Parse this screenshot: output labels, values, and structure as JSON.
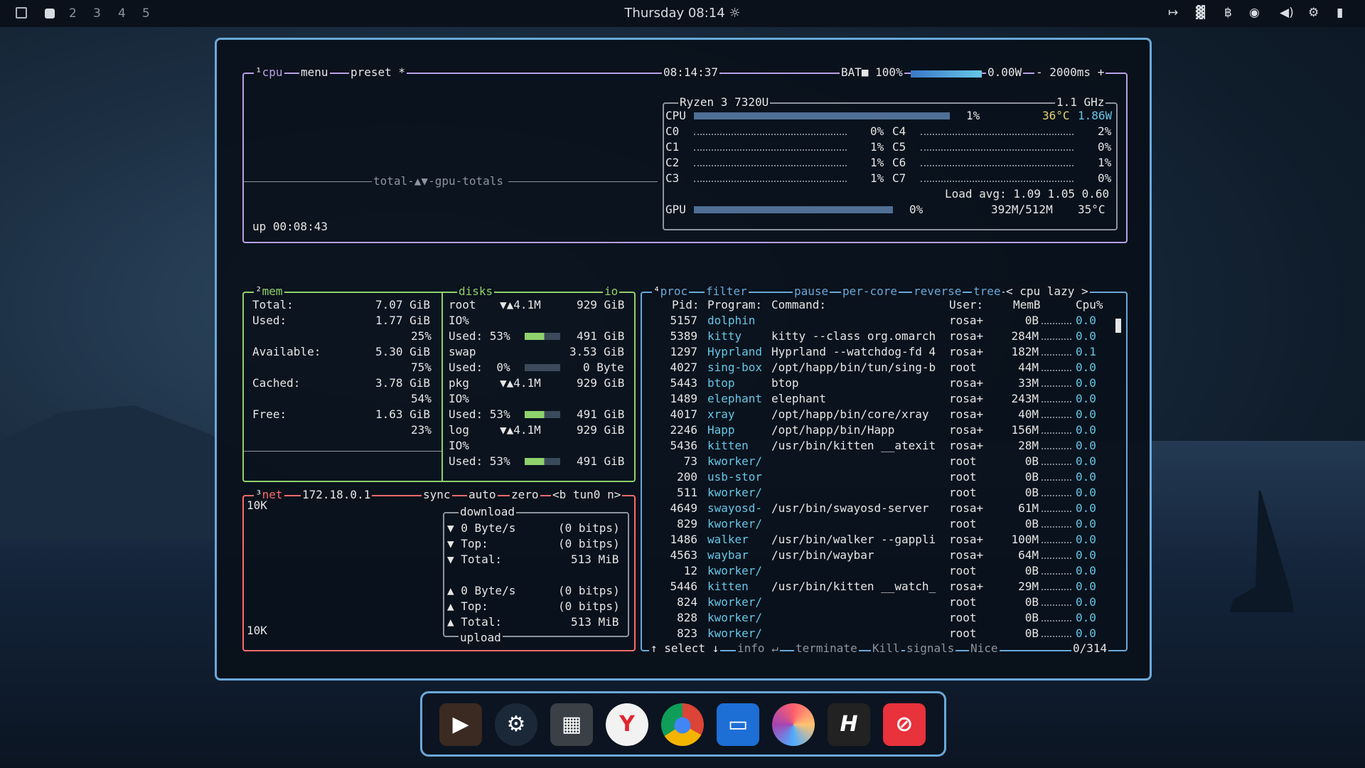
{
  "topbar": {
    "workspaces": [
      "2",
      "3",
      "4",
      "5"
    ],
    "clock": "Thursday 08:14 ☼",
    "tray": [
      "↦",
      "▓",
      "฿",
      "◉",
      "◀)",
      "⚙",
      "▮"
    ]
  },
  "cpu_box": {
    "title": "cpu",
    "menu": "menu",
    "preset": "preset *",
    "time": "08:14:37",
    "battery": "BAT■ 100%",
    "power": "0.00W",
    "interval": "- 2000ms +",
    "graph_label": "total-▲▼-gpu-totals",
    "uptime": "up 00:08:43",
    "model": "Ryzen 3 7320U",
    "freq": "1.1 GHz",
    "cpu_label": "CPU",
    "cpu_pct": "1%",
    "cpu_temp": "36°C",
    "cpu_power": "1.86W",
    "cores": [
      {
        "name": "C0",
        "pct": "0%"
      },
      {
        "name": "C1",
        "pct": "1%"
      },
      {
        "name": "C2",
        "pct": "1%"
      },
      {
        "name": "C3",
        "pct": "1%"
      },
      {
        "name": "C4",
        "pct": "2%"
      },
      {
        "name": "C5",
        "pct": "0%"
      },
      {
        "name": "C6",
        "pct": "1%"
      },
      {
        "name": "C7",
        "pct": "0%"
      }
    ],
    "load": "Load avg: 1.09 1.05 0.60",
    "gpu_label": "GPU",
    "gpu_pct": "0%",
    "gpu_mem": "392M/512M",
    "gpu_temp": "35°C"
  },
  "mem_box": {
    "title": "mem",
    "total_label": "Total:",
    "total": "7.07 GiB",
    "used_label": "Used:",
    "used": "1.77 GiB",
    "used_pct": "25%",
    "avail_label": "Available:",
    "avail": "5.30 GiB",
    "avail_pct": "75%",
    "cached_label": "Cached:",
    "cached": "3.78 GiB",
    "cached_pct": "54%",
    "free_label": "Free:",
    "free": "1.63 GiB",
    "free_pct": "23%"
  },
  "disks_box": {
    "title": "disks",
    "io": "io",
    "entries": [
      {
        "name": "root",
        "io": "▼▲4.1M",
        "size": "929 GiB",
        "io_label": "IO%",
        "used": "Used: 53%",
        "free": "491 GiB"
      },
      {
        "name": "swap",
        "size": "3.53 GiB",
        "used": "Used:  0%",
        "free": "0 Byte"
      },
      {
        "name": "pkg",
        "io": "▼▲4.1M",
        "size": "929 GiB",
        "io_label": "IO%",
        "used": "Used: 53%",
        "free": "491 GiB"
      },
      {
        "name": "log",
        "io": "▼▲4.1M",
        "size": "929 GiB",
        "io_label": "IO%",
        "used": "Used: 53%",
        "free": "491 GiB"
      }
    ]
  },
  "net_box": {
    "title": "net",
    "ip": "172.18.0.1",
    "sync": "sync",
    "auto": "auto",
    "zero": "zero",
    "iface": "<b tun0 n>",
    "scale_top": "10K",
    "scale_bottom": "10K",
    "download_title": "download",
    "upload_title": "upload",
    "down": [
      {
        "k": "▼ 0 Byte/s",
        "v": "(0 bitps)"
      },
      {
        "k": "▼ Top:",
        "v": "(0 bitps)"
      },
      {
        "k": "▼ Total:",
        "v": "513 MiB"
      }
    ],
    "up": [
      {
        "k": "▲ 0 Byte/s",
        "v": "(0 bitps)"
      },
      {
        "k": "▲ Top:",
        "v": "(0 bitps)"
      },
      {
        "k": "▲ Total:",
        "v": "513 MiB"
      }
    ]
  },
  "proc_box": {
    "title": "proc",
    "filter": "filter",
    "pause": "pause",
    "per_core": "per-core",
    "reverse": "reverse",
    "tree": "tree",
    "sort": "< cpu lazy >",
    "headers": {
      "pid": "Pid:",
      "program": "Program:",
      "command": "Command:",
      "user": "User:",
      "mem": "MemB",
      "cpu": "Cpu%"
    },
    "rows": [
      {
        "pid": "5157",
        "prog": "dolphin",
        "cmd": "",
        "user": "rosa+",
        "mem": "0B",
        "cpu": "0.0"
      },
      {
        "pid": "5389",
        "prog": "kitty",
        "cmd": "kitty --class org.omarch",
        "user": "rosa+",
        "mem": "284M",
        "cpu": "0.0"
      },
      {
        "pid": "1297",
        "prog": "Hyprland",
        "cmd": "Hyprland --watchdog-fd 4",
        "user": "rosa+",
        "mem": "182M",
        "cpu": "0.1"
      },
      {
        "pid": "4027",
        "prog": "sing-box",
        "cmd": "/opt/happ/bin/tun/sing-b",
        "user": "root",
        "mem": "44M",
        "cpu": "0.0"
      },
      {
        "pid": "5443",
        "prog": "btop",
        "cmd": "btop",
        "user": "rosa+",
        "mem": "33M",
        "cpu": "0.0"
      },
      {
        "pid": "1489",
        "prog": "elephant",
        "cmd": "elephant",
        "user": "rosa+",
        "mem": "243M",
        "cpu": "0.0"
      },
      {
        "pid": "4017",
        "prog": "xray",
        "cmd": "/opt/happ/bin/core/xray",
        "user": "rosa+",
        "mem": "40M",
        "cpu": "0.0"
      },
      {
        "pid": "2246",
        "prog": "Happ",
        "cmd": "/opt/happ/bin/Happ",
        "user": "rosa+",
        "mem": "156M",
        "cpu": "0.0"
      },
      {
        "pid": "5436",
        "prog": "kitten",
        "cmd": "/usr/bin/kitten __atexit",
        "user": "rosa+",
        "mem": "28M",
        "cpu": "0.0"
      },
      {
        "pid": "73",
        "prog": "kworker/",
        "cmd": "",
        "user": "root",
        "mem": "0B",
        "cpu": "0.0"
      },
      {
        "pid": "200",
        "prog": "usb-stor",
        "cmd": "",
        "user": "root",
        "mem": "0B",
        "cpu": "0.0"
      },
      {
        "pid": "511",
        "prog": "kworker/",
        "cmd": "",
        "user": "root",
        "mem": "0B",
        "cpu": "0.0"
      },
      {
        "pid": "4649",
        "prog": "swayosd-",
        "cmd": "/usr/bin/swayosd-server",
        "user": "rosa+",
        "mem": "61M",
        "cpu": "0.0"
      },
      {
        "pid": "829",
        "prog": "kworker/",
        "cmd": "",
        "user": "root",
        "mem": "0B",
        "cpu": "0.0"
      },
      {
        "pid": "1486",
        "prog": "walker",
        "cmd": "/usr/bin/walker --gappli",
        "user": "rosa+",
        "mem": "100M",
        "cpu": "0.0"
      },
      {
        "pid": "4563",
        "prog": "waybar",
        "cmd": "/usr/bin/waybar",
        "user": "rosa+",
        "mem": "64M",
        "cpu": "0.0"
      },
      {
        "pid": "12",
        "prog": "kworker/",
        "cmd": "",
        "user": "root",
        "mem": "0B",
        "cpu": "0.0"
      },
      {
        "pid": "5446",
        "prog": "kitten",
        "cmd": "/usr/bin/kitten __watch_",
        "user": "rosa+",
        "mem": "29M",
        "cpu": "0.0"
      },
      {
        "pid": "824",
        "prog": "kworker/",
        "cmd": "",
        "user": "root",
        "mem": "0B",
        "cpu": "0.0"
      },
      {
        "pid": "828",
        "prog": "kworker/",
        "cmd": "",
        "user": "root",
        "mem": "0B",
        "cpu": "0.0"
      },
      {
        "pid": "823",
        "prog": "kworker/",
        "cmd": "",
        "user": "root",
        "mem": "0B",
        "cpu": "0.0"
      }
    ],
    "footer": {
      "select": "↑ select ↓",
      "info": "info ↵",
      "terminate": "terminate",
      "kill": "Kill",
      "signals": "signals",
      "nice": "Nice",
      "count": "0/314"
    }
  },
  "dock": {
    "apps": [
      "terminal",
      "steam",
      "calculator",
      "yandex",
      "chrome",
      "files",
      "figma",
      "h-app",
      "blocker"
    ]
  }
}
